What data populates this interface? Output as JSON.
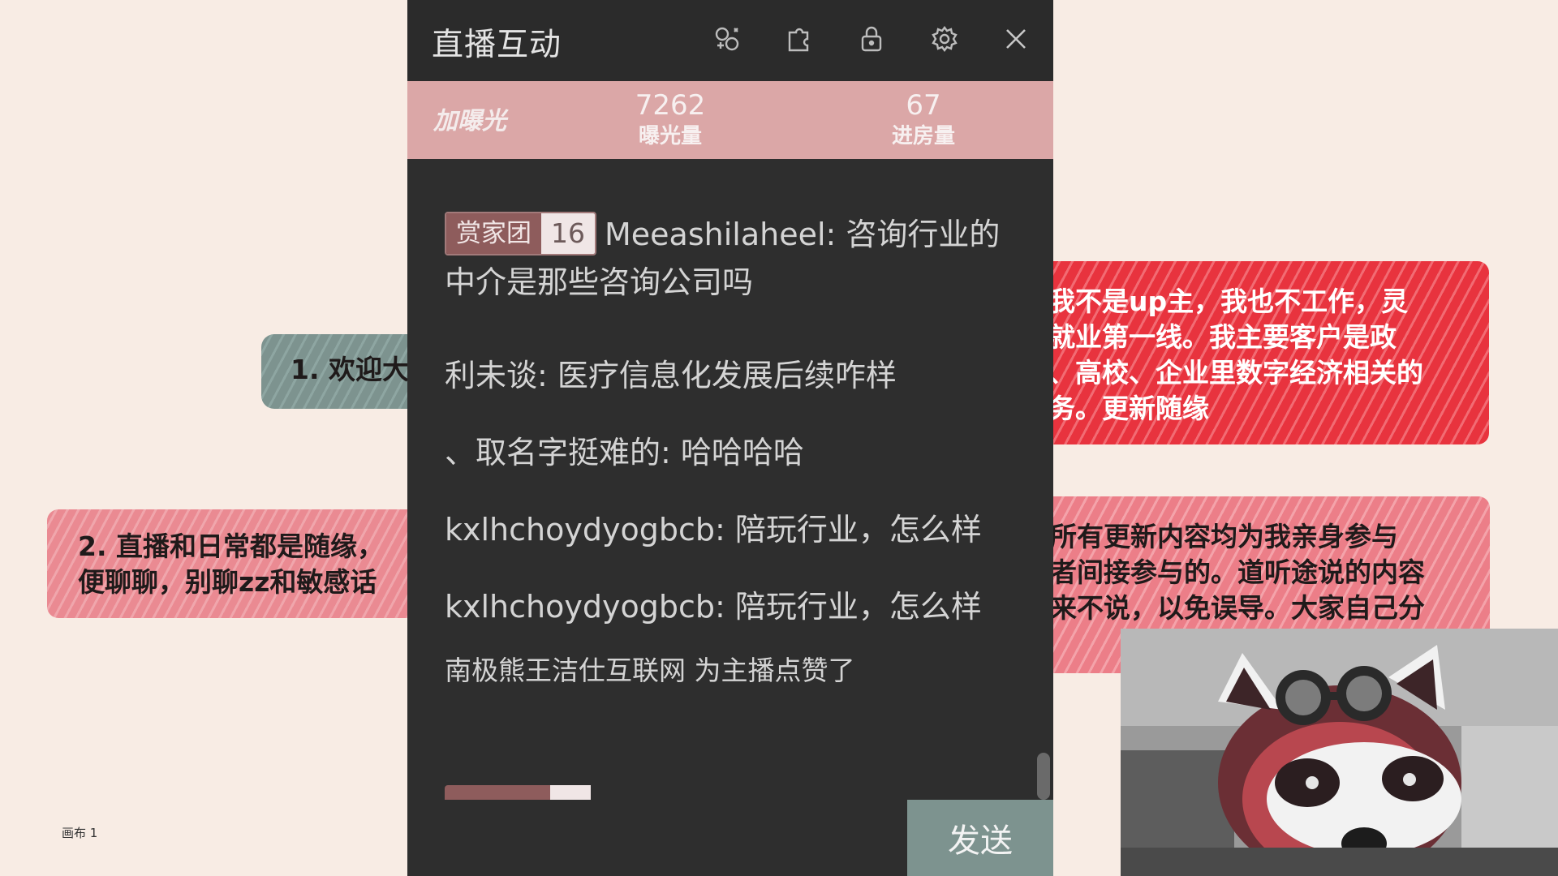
{
  "canvas": {
    "sticker_gray": "1. 欢迎大",
    "sticker_pink_left": [
      "2. 直播和日常都是随缘，",
      "便聊聊，别聊zz和敏感话"
    ],
    "sticker_red_right": [
      "我不是up主，我也不工作，灵",
      "就业第一线。我主要客户是政",
      "、高校、企业里数字经济相关的",
      "务。更新随缘"
    ],
    "sticker_pink_right": [
      "所有更新内容均为我亲身参与",
      "者间接参与的。道听途说的内容",
      "来不说，以免误导。大家自己分"
    ],
    "label": "画布 1",
    "art_subject": "raccoon-with-goggles"
  },
  "panel": {
    "title": "直播互动",
    "icons": [
      "games-icon",
      "puzzle-icon",
      "lock-icon",
      "gear-icon",
      "close-icon"
    ],
    "stats": {
      "cta": "加曝光",
      "exposure_value": "7262",
      "exposure_label": "曝光量",
      "entries_value": "67",
      "entries_label": "进房量"
    },
    "messages": [
      {
        "badge_name": "赏家团",
        "badge_level": "16",
        "user": "Meeashilaheel",
        "text": "咨询行业的中介是那些咨询公司吗"
      },
      {
        "user": "利未谈",
        "text": "医疗信息化发展后续咋样"
      },
      {
        "user": "、取名字挺难的",
        "text": "哈哈哈哈"
      },
      {
        "user": "kxlhchoydyogbcb",
        "text": "陪玩行业，怎么样"
      },
      {
        "user": "kxlhchoydyogbcb",
        "text": "陪玩行业，怎么样"
      },
      {
        "text": "南极熊王洁仕互联网 为主播点赞了"
      }
    ],
    "send_label": "发送"
  }
}
